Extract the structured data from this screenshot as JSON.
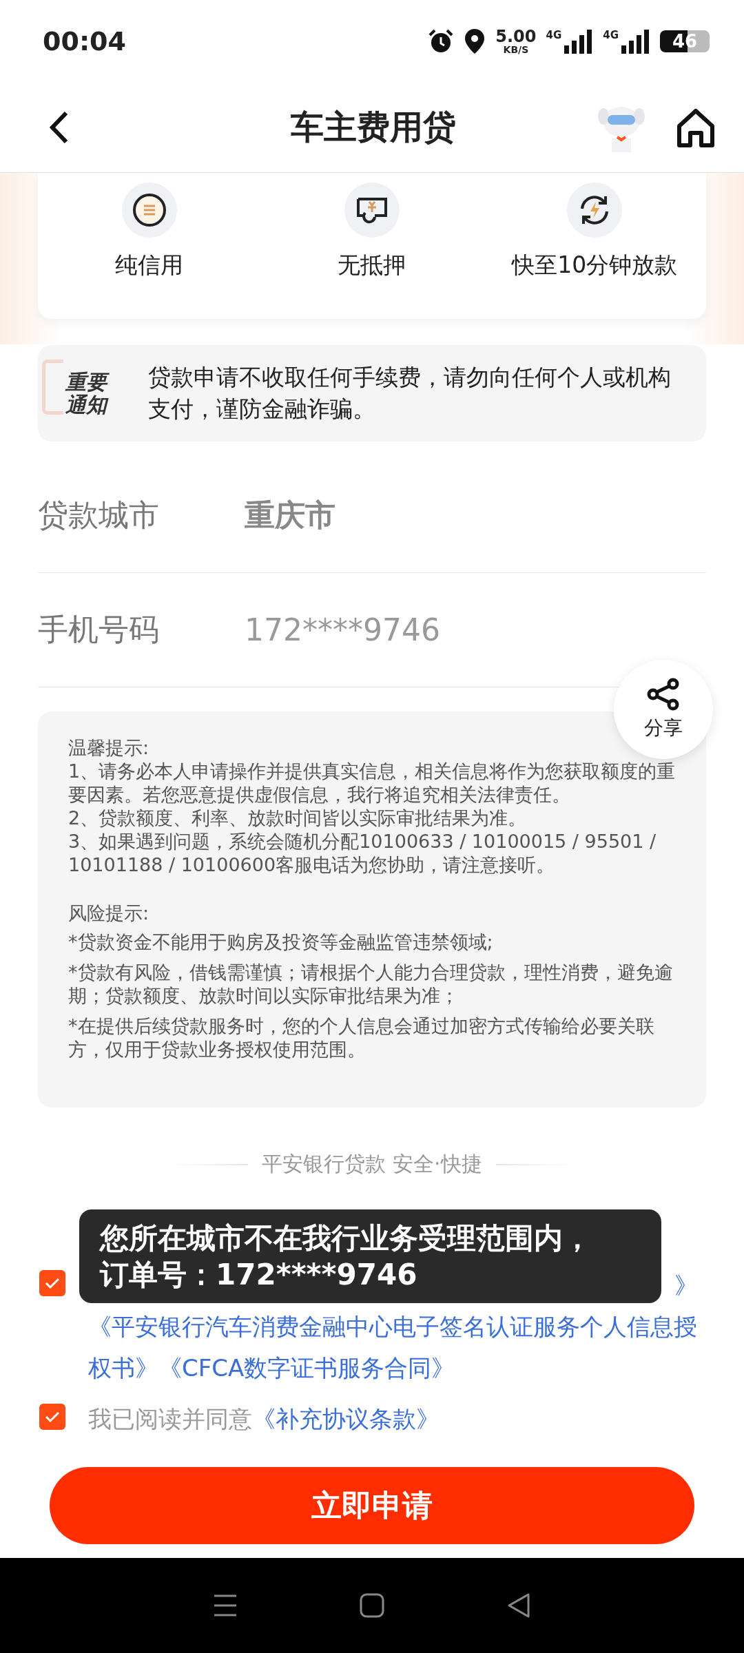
{
  "status_bar": {
    "time": "00:04",
    "speed": "5.00",
    "speed_unit": "KB/S",
    "networks": [
      "4G",
      "4G"
    ],
    "battery": "46"
  },
  "header": {
    "title": "车主费用贷"
  },
  "features": [
    {
      "kind": "credit",
      "label": "纯信用"
    },
    {
      "kind": "collateral",
      "label": "无抵押"
    },
    {
      "kind": "fast",
      "label": "快至10分钟放款"
    }
  ],
  "notice": {
    "badge": [
      "重要",
      "通知"
    ],
    "text": "贷款申请不收取任何手续费，请勿向任何个人或机构支付，谨防金融诈骗。"
  },
  "form": [
    {
      "label": "贷款城市",
      "value": "重庆市",
      "kind": "bold"
    },
    {
      "label": "手机号码",
      "value": "172****9746",
      "kind": "plain"
    }
  ],
  "tips": {
    "title": "温馨提示:",
    "lines": [
      "1、请务必本人申请操作并提供真实信息，相关信息将作为您获取额度的重要因素。若您恶意提供虚假信息，我行将追究相关法律责任。",
      "2、贷款额度、利率、放款时间皆以实际审批结果为准。",
      "3、如果遇到问题，系统会随机分配10100633 / 10100015 / 95501 / 10101188 / 10100600客服电话为您协助，请注意接听。"
    ],
    "risk_title": "风险提示:",
    "risk_items": [
      "*贷款资金不能用于购房及投资等金融监管违禁领域;",
      "*贷款有风险，借钱需谨慎；请根据个人能力合理贷款，理性消费，避免逾期；贷款额度、放款时间以实际审批结果为准；",
      "*在提供后续贷款服务时，您的个人信息会通过加密方式传输给必要关联方，仅用于贷款业务授权使用范围。"
    ]
  },
  "share": {
    "label": "分享"
  },
  "slogan": "平安银行贷款 安全·快捷",
  "agreements": [
    {
      "checked": true,
      "covered_tail": "》",
      "links": [
        "《平安银行汽车消费金融中心电子签名认证服务个人信息授权书》",
        "《CFCA数字证书服务合同》"
      ]
    },
    {
      "checked": true,
      "prefix": "我已阅读并同意",
      "links": [
        "《补充协议条款》"
      ]
    }
  ],
  "toast": {
    "lines": [
      "您所在城市不在我行业务受理范围内，",
      "订单号：172****9746"
    ]
  },
  "apply_button": "立即申请"
}
